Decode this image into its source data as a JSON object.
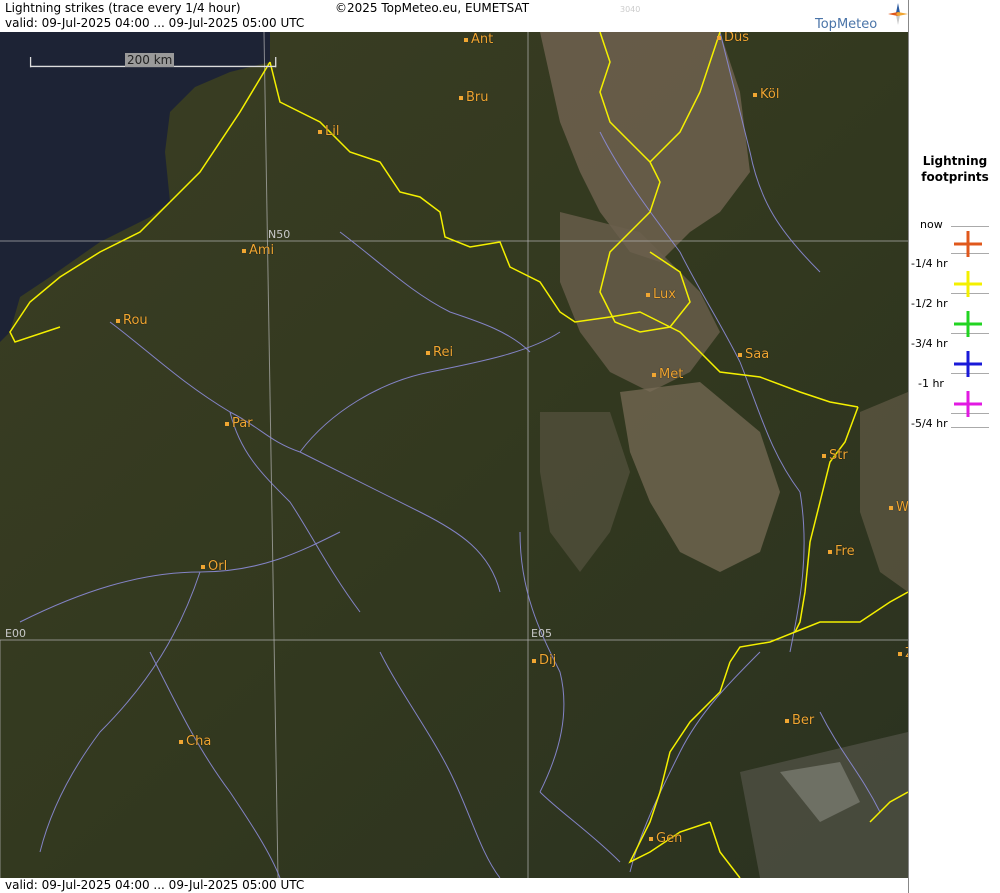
{
  "header": {
    "title": "Lightning strikes (trace every 1/4 hour)",
    "valid": "valid:  09-Jul-2025 04:00 ... 09-Jul-2025 05:00 UTC",
    "copyright": "©2025 TopMeteo.eu, EUMETSAT",
    "code": "3040"
  },
  "footer": {
    "valid": "valid:  09-Jul-2025 04:00 ... 09-Jul-2025 05:00 UTC"
  },
  "logo": {
    "text": "TopMeteo"
  },
  "scale": {
    "label": "200 km"
  },
  "grid": {
    "n50": "N50",
    "e00": "E00",
    "e05": "E05"
  },
  "cities": [
    {
      "name": "Ant"
    },
    {
      "name": "Düs"
    },
    {
      "name": "Köl"
    },
    {
      "name": "Bru"
    },
    {
      "name": "Lil"
    },
    {
      "name": "Ami"
    },
    {
      "name": "Rou"
    },
    {
      "name": "Lux"
    },
    {
      "name": "Rei"
    },
    {
      "name": "Saa"
    },
    {
      "name": "Met"
    },
    {
      "name": "Par"
    },
    {
      "name": "Str"
    },
    {
      "name": "W"
    },
    {
      "name": "Fre"
    },
    {
      "name": "Orl"
    },
    {
      "name": "Dij"
    },
    {
      "name": "Z"
    },
    {
      "name": "Ber"
    },
    {
      "name": "Cha"
    },
    {
      "name": "Gen"
    }
  ],
  "legend": {
    "title_line1": "Lightning",
    "title_line2": "footprints",
    "items": [
      {
        "label": "now",
        "color": ""
      },
      {
        "label": "-1/4 hr",
        "color": "#e0581c"
      },
      {
        "label": "-1/2 hr",
        "color": "#f4f000"
      },
      {
        "label": "-3/4 hr",
        "color": "#22d422"
      },
      {
        "label": "-1 hr",
        "color": "#1a1ad8"
      },
      {
        "label": "-5/4 hr",
        "color": "#e21ae2"
      }
    ]
  },
  "colors": {
    "border": "#f4f000",
    "river": "#8c8cd8",
    "city": "#f0a632",
    "sea": "#1d2335"
  }
}
